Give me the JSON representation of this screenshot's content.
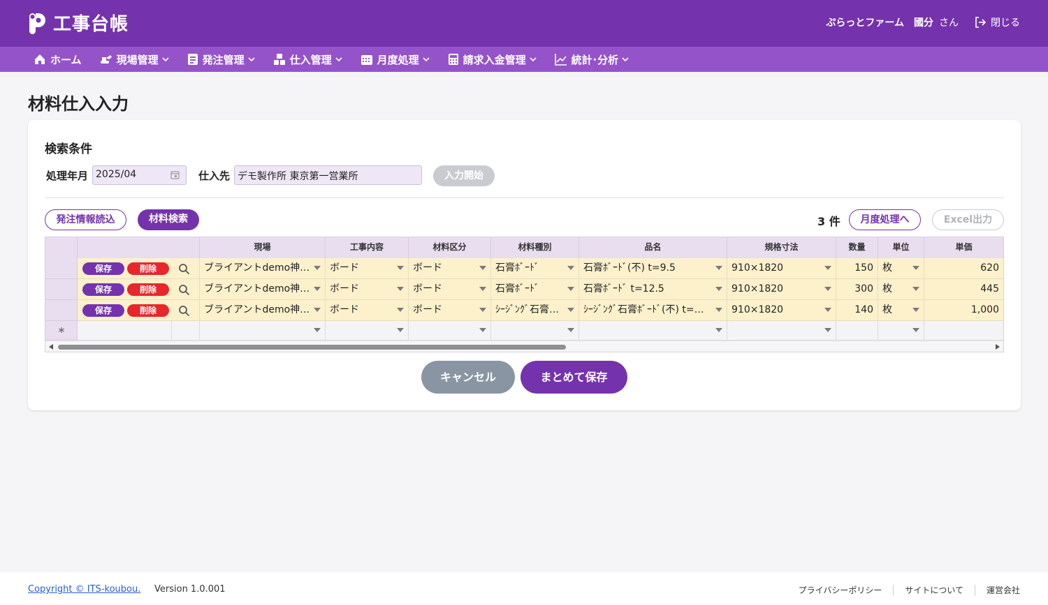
{
  "header": {
    "app_title": "工事台帳",
    "company": "ぷらっとファーム",
    "user_name": "國分",
    "honorific": "さん",
    "logout_label": "閉じる"
  },
  "nav": {
    "items": [
      {
        "label": "ホーム",
        "icon": "home-icon"
      },
      {
        "label": "現場管理",
        "icon": "excavator-icon"
      },
      {
        "label": "発注管理",
        "icon": "order-list-icon"
      },
      {
        "label": "仕入管理",
        "icon": "boxes-icon"
      },
      {
        "label": "月度処理",
        "icon": "calendar-icon"
      },
      {
        "label": "請求入金管理",
        "icon": "calculator-icon"
      },
      {
        "label": "統計･分析",
        "icon": "chart-line-icon"
      }
    ]
  },
  "page": {
    "title": "材料仕入入力"
  },
  "search": {
    "section_title": "検索条件",
    "period_label": "処理年月",
    "period_value": "2025/04",
    "supplier_label": "仕入先",
    "supplier_value": "デモ製作所 東京第一営業所",
    "start_button": "入力開始"
  },
  "toolbar": {
    "load_order_label": "発注情報読込",
    "material_search_label": "材料検索",
    "count_text": "3 件",
    "monthly_label": "月度処理へ",
    "excel_label": "Excel出力"
  },
  "grid": {
    "columns": [
      "現場",
      "工事内容",
      "材料区分",
      "材料種別",
      "品名",
      "規格寸法",
      "数量",
      "単位",
      "単価"
    ],
    "save_label": "保存",
    "delete_label": "削除",
    "new_row_marker": "*",
    "rows": [
      {
        "site": "ブライアントdemo神…",
        "work": "ボード",
        "category": "ボード",
        "type": "石膏ﾎﾞｰﾄﾞ",
        "item": "石膏ﾎﾞｰﾄﾞ(不) t=9.5",
        "size": "910×1820",
        "qty": "150",
        "unit": "枚",
        "price": "620"
      },
      {
        "site": "ブライアントdemo神…",
        "work": "ボード",
        "category": "ボード",
        "type": "石膏ﾎﾞｰﾄﾞ",
        "item": "石膏ﾎﾞｰﾄﾞ t=12.5",
        "size": "910×1820",
        "qty": "300",
        "unit": "枚",
        "price": "445"
      },
      {
        "site": "ブライアントdemo神…",
        "work": "ボード",
        "category": "ボード",
        "type": "ｼｰｼﾞﾝｸﾞ石膏…",
        "item": "ｼｰｼﾞﾝｸﾞ石膏ﾎﾞｰﾄﾞ(不) t=…",
        "size": "910×1820",
        "qty": "140",
        "unit": "枚",
        "price": "1,000"
      }
    ]
  },
  "actions": {
    "cancel_label": "キャンセル",
    "save_all_label": "まとめて保存"
  },
  "footer": {
    "copyright": "Copyright © ITS-koubou.",
    "version": "Version 1.0.001",
    "links": [
      "プライバシーポリシー",
      "サイトについて",
      "運営会社"
    ]
  },
  "colors": {
    "header_bg": "#7433ad",
    "nav_bg": "#9553c9",
    "grid_header_bg": "#e9deef",
    "row_bg": "#fdf1cc",
    "delete_red": "#e8262b",
    "cancel_gray": "#8a95a3"
  }
}
